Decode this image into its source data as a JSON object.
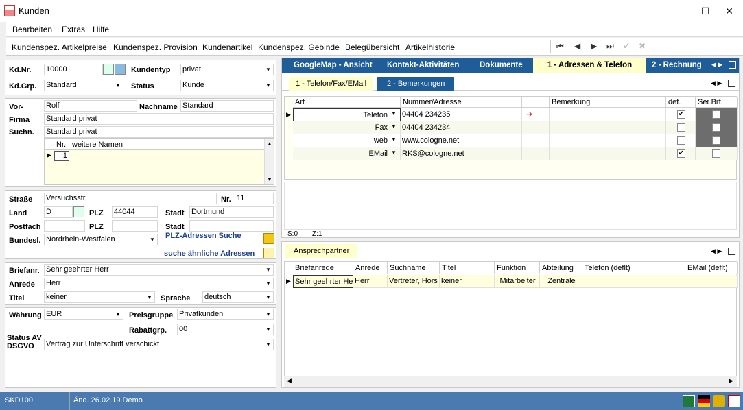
{
  "window": {
    "title": "Kunden",
    "min": "—",
    "max": "☐",
    "close": "✕"
  },
  "menu": [
    "Bearbeiten",
    "Extras",
    "Hilfe"
  ],
  "toolbar": [
    "Kundenspez. Artikelpreise",
    "Kundenspez. Provision",
    "Kundenartikel",
    "Kundenspez. Gebinde",
    "Belegübersicht",
    "Artikelhistorie"
  ],
  "nav": {
    "first": "⏮",
    "prev": "◀",
    "next": "▶",
    "last": "⏭",
    "ok": "✔",
    "cancel": "✖"
  },
  "customer": {
    "kdnr_label": "Kd.Nr.",
    "kdnr": "10000",
    "kundentyp_label": "Kundentyp",
    "kundentyp": "privat",
    "kdgrp_label": "Kd.Grp.",
    "kdgrp": "Standard",
    "status_label": "Status",
    "status": "Kunde",
    "vor_label": "Vor-",
    "vorname": "Rolf",
    "nachname_label": "Nachname",
    "nachname": "Standard",
    "firma_label": "Firma",
    "firma": "Standard privat",
    "suchn_label": "Suchn.",
    "suchname": "Standard privat",
    "names_col_nr": "Nr.",
    "names_col_name": "weitere Namen",
    "names_row_nr": "1",
    "strasse_label": "Straße",
    "strasse": "Versuchsstr.",
    "nr_label": "Nr.",
    "nr": "11",
    "land_label": "Land",
    "land": "D",
    "plz_label": "PLZ",
    "plz": "44044",
    "stadt_label": "Stadt",
    "stadt": "Dortmund",
    "postfach_label": "Postfach",
    "plz2_label": "PLZ",
    "stadt2_label": "Stadt",
    "bundesl_label": "Bundesl.",
    "bundesland": "Nordrhein-Westfalen",
    "plz_search": "PLZ-Adressen Suche",
    "similar_search": "suche ähnliche Adressen",
    "briefanr_label": "Briefanr.",
    "briefanrede": "Sehr geehrter Herr",
    "anrede_label": "Anrede",
    "anrede": "Herr",
    "titel_label": "Titel",
    "titel": "keiner",
    "sprache_label": "Sprache",
    "sprache": "deutsch",
    "waehrung_label": "Währung",
    "waehrung": "EUR",
    "preisgruppe_label": "Preisgruppe",
    "preisgruppe": "Privatkunden",
    "rabattgrp_label": "Rabattgrp.",
    "rabattgrp": "00",
    "statusav_label": "Status AV",
    "dsgvo_label": "DSGVO",
    "dsgvo": "Vertrag zur Unterschrift verschickt"
  },
  "tabs": [
    "GoogleMap - Ansicht",
    "Kontakt-Aktivitäten",
    "Dokumente",
    "1 - Adressen & Telefon",
    "2 - Rechnung"
  ],
  "subtabs": [
    "1 - Telefon/Fax/EMail",
    "2 - Bemerkungen"
  ],
  "contact_cols": [
    "Art",
    "Nummer/Adresse",
    "Bemerkung",
    "def.",
    "Ser.Brf."
  ],
  "contacts": [
    {
      "art": "Telefon",
      "nummer": "04404 234235",
      "def": true
    },
    {
      "art": "Fax",
      "nummer": "04404 234234",
      "def": false
    },
    {
      "art": "web",
      "nummer": "www.cologne.net",
      "def": false
    },
    {
      "art": "EMail",
      "nummer": "RKS@cologne.net",
      "def": true
    }
  ],
  "grid_status": {
    "s": "S:0",
    "z": "Z:1"
  },
  "ansprech_tab": "Ansprechpartner",
  "ansprech_cols": [
    "Briefanrede",
    "Anrede",
    "Suchname",
    "Titel",
    "Funktion",
    "Abteilung",
    "Telefon (deflt)",
    "EMail (deflt)"
  ],
  "ansprech_row": [
    "Sehr geehrter He",
    "Herr",
    "Vertreter, Hors",
    "keiner",
    "Mitarbeiter",
    "Zentrale",
    "",
    ""
  ],
  "statusbar": {
    "code": "SKD100",
    "changed": "Änd. 26.02.19 Demo"
  }
}
